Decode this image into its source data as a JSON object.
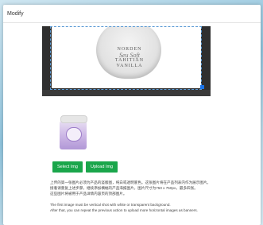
{
  "modal": {
    "title": "Modify"
  },
  "crop": {
    "photo_brand": "NORDEN",
    "photo_script": "Seu Soft",
    "photo_line1": "TAHITIAN",
    "photo_line2": "VANILLA"
  },
  "buttons": {
    "select": "Select Img",
    "upload": "Upload Img"
  },
  "instructions": {
    "cn_line1": "上传的第一张图片必须为产品的竖版图，纯白或透明底色。这张图片将在产品列表内作为展示图片。",
    "cn_line2": "接着请重复上述步骤，继续添加横幅的产品海报图片，图片尺寸为750 x 750px，最多四张。",
    "cn_line3": "这些图片将被用于产品详情内容页的顶部图片。",
    "en_line1": "The first image must be vertical shot with white or transparent background.",
    "en_line2": "After that, you can repeat the previous action to upload more horizontal images as banners."
  },
  "colors": {
    "button_green": "#1aa64b",
    "crop_border": "#5b9bd5"
  }
}
